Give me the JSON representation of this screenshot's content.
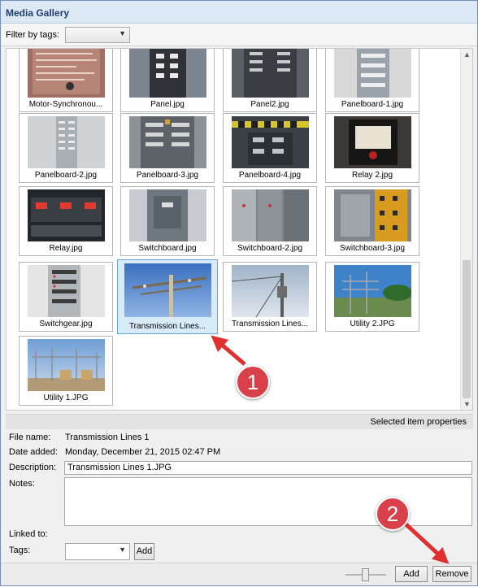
{
  "window": {
    "title": "Media Gallery"
  },
  "toolbar": {
    "filter_label": "Filter by tags:",
    "filter_value": ""
  },
  "gallery": {
    "items": [
      {
        "caption": "Motor-Synchronou..."
      },
      {
        "caption": "Panel.jpg"
      },
      {
        "caption": "Panel2.jpg"
      },
      {
        "caption": "Panelboard-1.jpg"
      },
      {
        "caption": "Panelboard-2.jpg"
      },
      {
        "caption": "Panelboard-3.jpg"
      },
      {
        "caption": "Panelboard-4.jpg"
      },
      {
        "caption": "Relay 2.jpg"
      },
      {
        "caption": "Relay.jpg"
      },
      {
        "caption": "Switchboard.jpg"
      },
      {
        "caption": "Switchboard-2.jpg"
      },
      {
        "caption": "Switchboard-3.jpg"
      },
      {
        "caption": "Switchgear.jpg"
      },
      {
        "caption": "Transmission Lines..."
      },
      {
        "caption": "Transmission Lines..."
      },
      {
        "caption": "Utility 2.JPG"
      },
      {
        "caption": "Utility 1.JPG"
      }
    ],
    "selected_index": 13
  },
  "properties": {
    "header": "Selected item properties",
    "file_name_label": "File name:",
    "file_name": "Transmission Lines 1",
    "date_added_label": "Date added:",
    "date_added": "Monday, December 21, 2015 02:47 PM",
    "description_label": "Description:",
    "description": "Transmission Lines 1.JPG",
    "notes_label": "Notes:",
    "notes": "",
    "linked_to_label": "Linked to:",
    "tags_label": "Tags:",
    "tags_value": "",
    "tags_add_label": "Add"
  },
  "footer": {
    "add_label": "Add",
    "remove_label": "Remove"
  },
  "annotations": {
    "callout_1": "1",
    "callout_2": "2",
    "color": "#d9414a"
  }
}
